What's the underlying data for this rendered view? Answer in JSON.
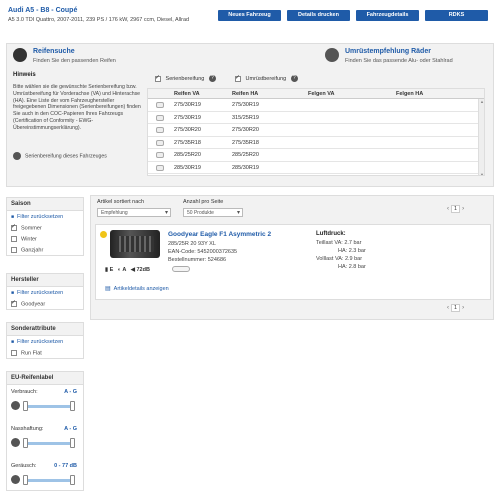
{
  "vehicle": {
    "title": "Audi A5 - B8 - Coupé",
    "description": "A5 3.0 TDI Quattro, 2007-2011, 239 PS / 176 kW, 2967 ccm, Diesel, Allrad"
  },
  "actions": [
    {
      "label": "Neues Fahrzeug"
    },
    {
      "label": "Details drucken"
    },
    {
      "label": "Fahrzeugdetails"
    },
    {
      "label": "RDKS"
    }
  ],
  "reifensuche": {
    "title": "Reifensuche",
    "subtitle": "Finden Sie den passenden Reifen"
  },
  "umruest": {
    "title": "Umrüstempfehlung Räder",
    "subtitle": "Finden Sie das passende Alu- oder Stahlrad"
  },
  "hinweis": {
    "title": "Hinweis",
    "text": "Bitte wählen sie die gewünschte Serienbereifung bzw. Umrüstbereifung für Vorderachse (VA) und Hinterachse (HA). Eine Liste der vom Fahrzeughersteller freigegebenen Dimensionen (Serienbereifungen) finden Sie auch in den COC-Papieren Ihres Fahrzeugs (Certification of Conformity - EWG-Übereinstimmungserklärung).",
    "serien_note": "Serienbereifung dieses Fahrzeuges"
  },
  "filters": {
    "serien": "Serienbereifung",
    "umruest": "Umrüstbereifung"
  },
  "tire_table": {
    "headers": [
      "Reifen VA",
      "Reifen HA",
      "Felgen VA",
      "Felgen HA"
    ],
    "rows": [
      [
        "275/30R19",
        "275/30R19"
      ],
      [
        "275/30R19",
        "315/25R19"
      ],
      [
        "275/30R20",
        "275/30R20"
      ],
      [
        "275/35R18",
        "275/35R18"
      ],
      [
        "285/25R20",
        "285/25R20"
      ],
      [
        "285/30R19",
        "285/30R19"
      ]
    ]
  },
  "saison": {
    "title": "Saison",
    "reset": "Filter zurücksetzen",
    "items": [
      "Sommer",
      "Winter",
      "Ganzjahr"
    ]
  },
  "hersteller": {
    "title": "Hersteller",
    "reset": "Filter zurücksetzen",
    "items": [
      "Goodyear"
    ]
  },
  "sonder": {
    "title": "Sonderattribute",
    "reset": "Filter zurücksetzen",
    "items": [
      "Run Flat"
    ]
  },
  "eu": {
    "title": "EU-Reifenlabel",
    "rows": [
      {
        "label": "Verbrauch:",
        "value": "A - G"
      },
      {
        "label": "Nasshaftung:",
        "value": "A - G"
      },
      {
        "label": "Geräusch:",
        "value": "0 - 77 dB"
      }
    ]
  },
  "results": {
    "sort_label": "Artikel sortiert nach",
    "sort_value": "Empfehlung",
    "per_page_label": "Anzahl pro Seite",
    "per_page_value": "50 Produkte",
    "page": "1"
  },
  "product": {
    "name": "Goodyear Eagle F1 Asymmetric 2",
    "size": "285/25R 20 93Y XL",
    "ean": "EAN-Code: 5452000372635",
    "order": "Bestellnummer: 524686",
    "luft_title": "Luftdruck:",
    "luft": [
      "Teillast VA: 2.7 bar",
      "HA: 2.3 bar",
      "Volllast VA: 2.9 bar",
      "HA: 2.8 bar"
    ],
    "eu_fuel": "E",
    "eu_wet": "A",
    "eu_noise": "72dB",
    "details_link": "Artikeldetails anzeigen"
  }
}
